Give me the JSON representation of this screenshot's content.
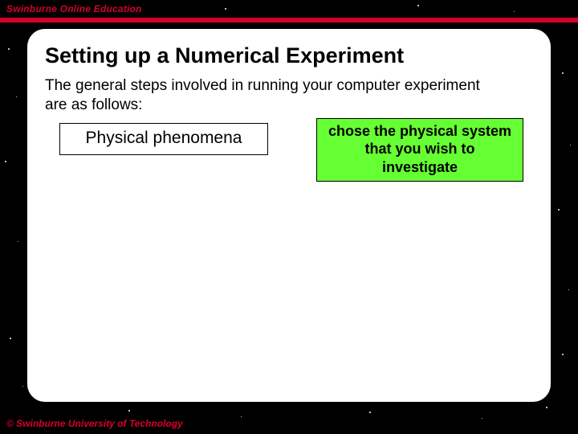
{
  "header": {
    "brand": "Swinburne Online Education"
  },
  "footer": {
    "copyright": "© Swinburne University of Technology"
  },
  "slide": {
    "title": "Setting up a Numerical Experiment",
    "intro": "The general steps involved in running your computer experiment are as follows:",
    "box_left": "Physical phenomena",
    "box_right": "chose the physical system that you wish to investigate"
  },
  "colors": {
    "accent": "#d6002a",
    "highlight": "#66ff33"
  }
}
